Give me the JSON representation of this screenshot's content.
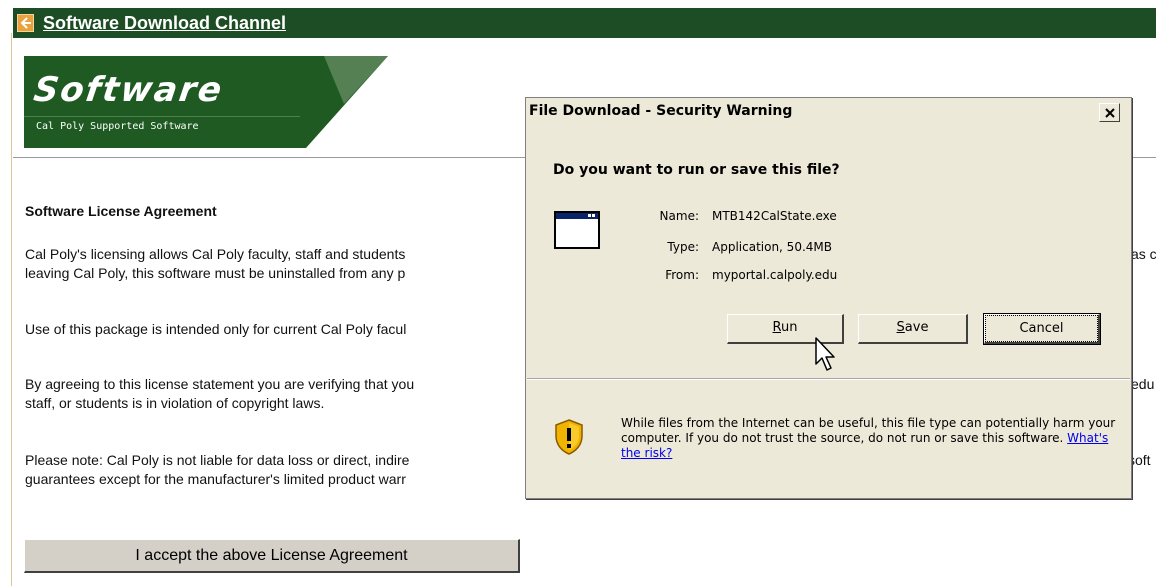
{
  "channel": {
    "title": "Software Download Channel",
    "back_icon": "back-arrow-icon"
  },
  "banner": {
    "title": "Software",
    "subtitle": "Cal Poly Supported Software"
  },
  "page": {
    "heading": "Software License Agreement",
    "para1_line1": "Cal Poly's licensing allows Cal Poly faculty, staff and students",
    "para1_line1_tail": "as c",
    "para1_line2": "leaving Cal Poly, this software must be uninstalled from any p",
    "para2": "Use of this package is intended only for current Cal Poly facul",
    "para3_line1": "By agreeing to this license statement you are verifying that you",
    "para3_line1_tail": "edu",
    "para3_line2": "staff, or students is in violation of copyright laws.",
    "para4_line1": "Please note: Cal Poly is not liable for data loss or direct, indire",
    "para4_line1_tail": "soft",
    "para4_line2": "guarantees except for the manufacturer's limited product warr",
    "accept_button": "I accept the above License Agreement"
  },
  "dialog": {
    "title": "File Download - Security Warning",
    "question": "Do you want to run or save this file?",
    "name_label": "Name:",
    "name_value": "MTB142CalState.exe",
    "type_label": "Type:",
    "type_value": "Application, 50.4MB",
    "from_label": "From:",
    "from_value": "myportal.calpoly.edu",
    "run_access": "R",
    "run_rest": "un",
    "save_access": "S",
    "save_rest": "ave",
    "cancel_label": "Cancel",
    "warning_text": "While files from the Internet can be useful, this file type can potentially harm your computer. If you do not trust the source, do not run or save this software.",
    "risk_link": "What's the risk?"
  },
  "colors": {
    "channel_bar": "#1d4d24",
    "banner_green": "#1f5a23",
    "dialog_bg": "#ece9d8",
    "link": "#0000ee",
    "shield_gold": "#f0b400"
  }
}
